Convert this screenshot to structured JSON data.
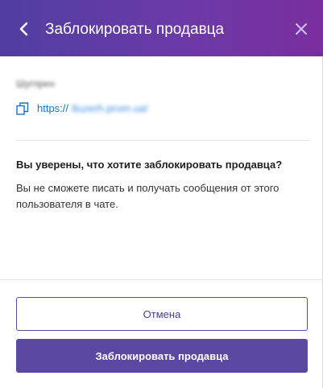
{
  "header": {
    "title": "Заблокировать продавца",
    "back_icon": "chevron-left-icon",
    "close_icon": "close-icon"
  },
  "seller": {
    "name": "Шугпрен",
    "link_icon": "copy-link-icon",
    "link_prefix": "https://",
    "link_host": "ttuzerh.prom.ua/"
  },
  "confirm": {
    "question": "Вы уверены, что хотите заблокировать продавца?",
    "description": "Вы не сможете писать и получать сообщения от этого пользователя в чате."
  },
  "actions": {
    "cancel_label": "Отмена",
    "block_label": "Заблокировать продавца"
  },
  "colors": {
    "header_gradient_start": "#4f3fa0",
    "header_gradient_end": "#7a2e9e",
    "primary": "#5a48a3",
    "link": "#1a73c8"
  }
}
